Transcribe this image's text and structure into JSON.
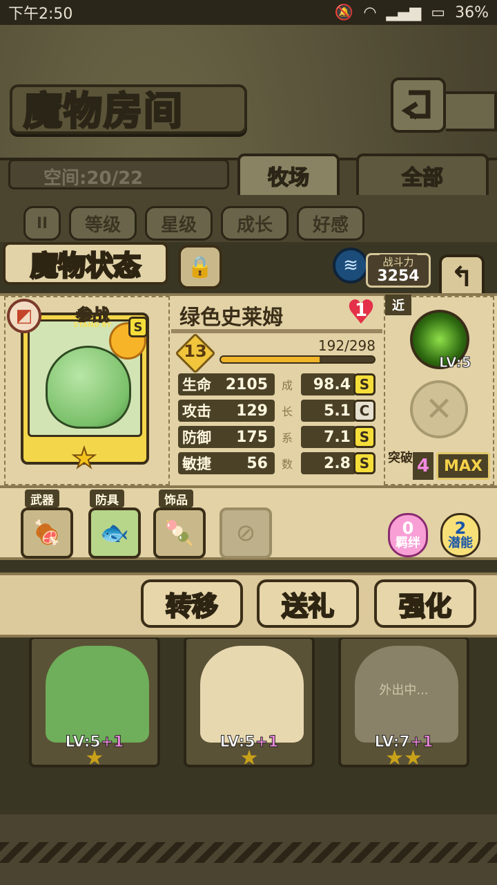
{
  "status_bar": {
    "time": "下午2:50",
    "battery": "36%"
  },
  "header": {
    "title": "魔物房间",
    "back_icon": "return-arrow-icon"
  },
  "room": {
    "space_label": "空间:20/22"
  },
  "tabs": [
    {
      "label": "牧场"
    },
    {
      "label": "全部"
    }
  ],
  "filters": {
    "pause": "II",
    "items": [
      {
        "label": "等级"
      },
      {
        "label": "星级"
      },
      {
        "label": "成长"
      },
      {
        "label": "好感"
      }
    ]
  },
  "status_panel": {
    "title": "魔物状态",
    "power_label": "战斗力",
    "power_value": "3254"
  },
  "monster": {
    "name": "绿色史莱姆",
    "standby": "参战",
    "standby_sub": "STAND BY",
    "rank": "S",
    "affection": "1",
    "level": "13",
    "exp_text": "192/298",
    "exp_fraction": 0.644,
    "stats": [
      {
        "name": "生命",
        "value": "2105",
        "growth_char": "成",
        "growth": "98.4",
        "grade": "S"
      },
      {
        "name": "攻击",
        "value": "129",
        "growth_char": "长",
        "growth": "5.1",
        "grade": "C"
      },
      {
        "name": "防御",
        "value": "175",
        "growth_char": "系",
        "growth": "7.1",
        "grade": "S"
      },
      {
        "name": "敏捷",
        "value": "56",
        "growth_char": "数",
        "growth": "2.8",
        "grade": "S"
      }
    ]
  },
  "skills": {
    "range_tag": "近",
    "skill_level": "LV:5",
    "breakthrough_label": "突破",
    "breakthrough_value": "4",
    "max_label": "MAX"
  },
  "equipment": {
    "weapon_label": "武器",
    "armor_label": "防具",
    "accessory_label": "饰品",
    "bond_value": "0",
    "bond_label": "羁绊",
    "potential_value": "2",
    "potential_label": "潜能"
  },
  "actions": [
    {
      "label": "转移"
    },
    {
      "label": "送礼"
    },
    {
      "label": "强化"
    }
  ],
  "roster": [
    {
      "level": "LV:5",
      "bonus": "+1",
      "stars": "★",
      "color": "#6fae5a"
    },
    {
      "level": "LV:5",
      "bonus": "+1",
      "stars": "★",
      "color": "#e8d8b0"
    },
    {
      "level": "LV:7",
      "bonus": "+1",
      "stars": "★★",
      "away": "外出中...",
      "color": "#8a8268"
    }
  ],
  "colors": {
    "accent_gold": "#f6de3a",
    "panel": "#e2d2a6",
    "frame": "#2a2516"
  }
}
